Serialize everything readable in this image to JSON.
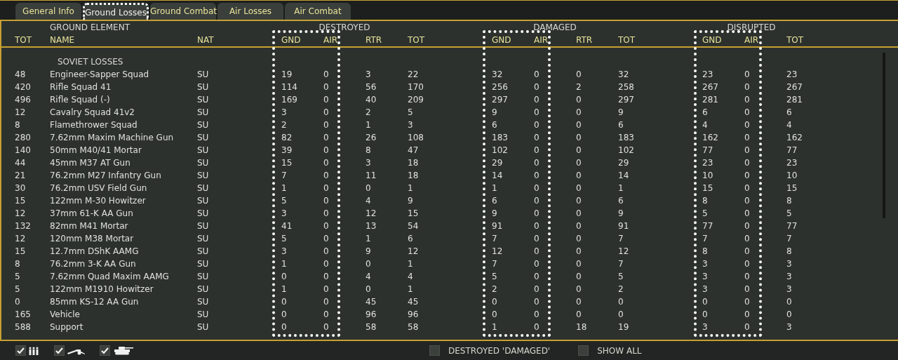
{
  "tabs": [
    {
      "label": "General Info",
      "selected": false
    },
    {
      "label": "Ground Losses",
      "selected": true
    },
    {
      "label": "Ground Combat",
      "selected": false
    },
    {
      "label": "Air Losses",
      "selected": false
    },
    {
      "label": "Air Combat",
      "selected": false
    }
  ],
  "table": {
    "groups": [
      {
        "label": "GROUND ELEMENT"
      },
      {
        "label": "DESTROYED",
        "highlighted": true
      },
      {
        "label": "DAMAGED",
        "highlighted": true
      },
      {
        "label": "DISRUPTED",
        "highlighted": true
      }
    ],
    "columns": [
      "TOT",
      "NAME",
      "NAT",
      "GND",
      "AIR",
      "RTR",
      "TOT",
      "GND",
      "AIR",
      "RTR",
      "TOT",
      "GND",
      "AIR",
      "TOT"
    ],
    "section": "SOVIET LOSSES",
    "rows": [
      [
        "48",
        "Engineer-Sapper Squad",
        "SU",
        "19",
        "0",
        "3",
        "22",
        "32",
        "0",
        "0",
        "32",
        "23",
        "0",
        "23"
      ],
      [
        "420",
        "Rifle Squad 41",
        "SU",
        "114",
        "0",
        "56",
        "170",
        "256",
        "0",
        "2",
        "258",
        "267",
        "0",
        "267"
      ],
      [
        "496",
        "Rifle Squad (-)",
        "SU",
        "169",
        "0",
        "40",
        "209",
        "297",
        "0",
        "0",
        "297",
        "281",
        "0",
        "281"
      ],
      [
        "12",
        "Cavalry Squad 41v2",
        "SU",
        "3",
        "0",
        "2",
        "5",
        "9",
        "0",
        "0",
        "9",
        "6",
        "0",
        "6"
      ],
      [
        "8",
        "Flamethrower Squad",
        "SU",
        "2",
        "0",
        "1",
        "3",
        "6",
        "0",
        "0",
        "6",
        "4",
        "0",
        "4"
      ],
      [
        "280",
        "7.62mm Maxim Machine Gun",
        "SU",
        "82",
        "0",
        "26",
        "108",
        "183",
        "0",
        "0",
        "183",
        "162",
        "0",
        "162"
      ],
      [
        "140",
        "50mm M40/41 Mortar",
        "SU",
        "39",
        "0",
        "8",
        "47",
        "102",
        "0",
        "0",
        "102",
        "77",
        "0",
        "77"
      ],
      [
        "44",
        "45mm M37 AT Gun",
        "SU",
        "15",
        "0",
        "3",
        "18",
        "29",
        "0",
        "0",
        "29",
        "23",
        "0",
        "23"
      ],
      [
        "21",
        "76.2mm M27 Infantry Gun",
        "SU",
        "7",
        "0",
        "11",
        "18",
        "14",
        "0",
        "0",
        "14",
        "10",
        "0",
        "10"
      ],
      [
        "30",
        "76.2mm USV Field Gun",
        "SU",
        "1",
        "0",
        "0",
        "1",
        "1",
        "0",
        "0",
        "1",
        "15",
        "0",
        "15"
      ],
      [
        "15",
        "122mm M-30 Howitzer",
        "SU",
        "5",
        "0",
        "4",
        "9",
        "6",
        "0",
        "0",
        "6",
        "8",
        "0",
        "8"
      ],
      [
        "12",
        "37mm 61-K AA Gun",
        "SU",
        "3",
        "0",
        "12",
        "15",
        "9",
        "0",
        "0",
        "9",
        "5",
        "0",
        "5"
      ],
      [
        "132",
        "82mm M41 Mortar",
        "SU",
        "41",
        "0",
        "13",
        "54",
        "91",
        "0",
        "0",
        "91",
        "77",
        "0",
        "77"
      ],
      [
        "12",
        "120mm M38 Mortar",
        "SU",
        "5",
        "0",
        "1",
        "6",
        "7",
        "0",
        "0",
        "7",
        "7",
        "0",
        "7"
      ],
      [
        "15",
        "12.7mm DShK AAMG",
        "SU",
        "3",
        "0",
        "9",
        "12",
        "12",
        "0",
        "0",
        "12",
        "8",
        "0",
        "8"
      ],
      [
        "8",
        "76.2mm 3-K AA Gun",
        "SU",
        "1",
        "0",
        "0",
        "1",
        "7",
        "0",
        "0",
        "7",
        "3",
        "0",
        "3"
      ],
      [
        "5",
        "7.62mm Quad Maxim AAMG",
        "SU",
        "0",
        "0",
        "4",
        "4",
        "5",
        "0",
        "0",
        "5",
        "3",
        "0",
        "3"
      ],
      [
        "5",
        "122mm M1910 Howitzer",
        "SU",
        "1",
        "0",
        "0",
        "1",
        "2",
        "0",
        "0",
        "2",
        "3",
        "0",
        "3"
      ],
      [
        "0",
        "85mm KS-12 AA Gun",
        "SU",
        "0",
        "0",
        "45",
        "45",
        "0",
        "0",
        "0",
        "0",
        "0",
        "0",
        "0"
      ],
      [
        "165",
        "Vehicle",
        "SU",
        "0",
        "0",
        "96",
        "96",
        "0",
        "0",
        "0",
        "0",
        "0",
        "0",
        "0"
      ],
      [
        "588",
        "Support",
        "SU",
        "0",
        "0",
        "58",
        "58",
        "1",
        "0",
        "18",
        "19",
        "3",
        "0",
        "3"
      ]
    ]
  },
  "footer": {
    "filters": [
      {
        "kind": "infantry",
        "checked": true
      },
      {
        "kind": "gun",
        "checked": true
      },
      {
        "kind": "tank",
        "checked": true
      }
    ],
    "options": [
      {
        "label": "DESTROYED 'DAMAGED'",
        "checked": false
      },
      {
        "label": "SHOW ALL",
        "checked": false
      }
    ]
  }
}
